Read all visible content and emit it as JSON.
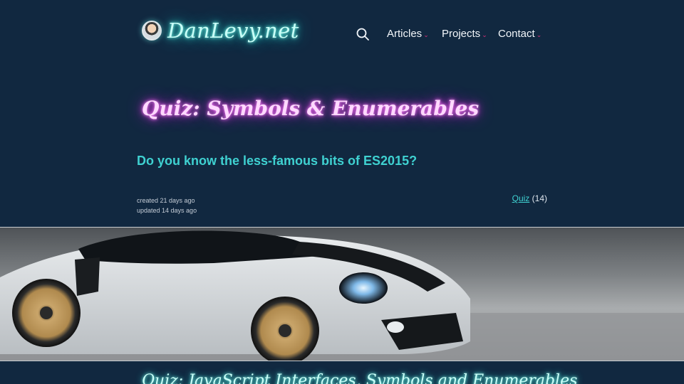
{
  "site": {
    "logo_text": "DanLevy.net"
  },
  "nav": {
    "items": [
      {
        "label": "Articles"
      },
      {
        "label": "Projects"
      },
      {
        "label": "Contact"
      }
    ]
  },
  "article": {
    "title": "Quiz: Symbols & Enumerables",
    "subtitle": "Do you know the less-famous bits of ES2015?",
    "created": "created 21 days ago",
    "updated": "updated 14 days ago",
    "tag_label": "Quiz",
    "tag_count": "(14)"
  },
  "next_article": {
    "title": "Quiz: JavaScript Interfaces, Symbols and Enumerables"
  },
  "colors": {
    "background": "#112840",
    "accent_cyan": "#3fd1d1",
    "accent_magenta": "#e040e0",
    "caret_pink": "#e0307a"
  },
  "icons": {
    "search": "search-icon",
    "caret": "chevron-down-icon"
  }
}
